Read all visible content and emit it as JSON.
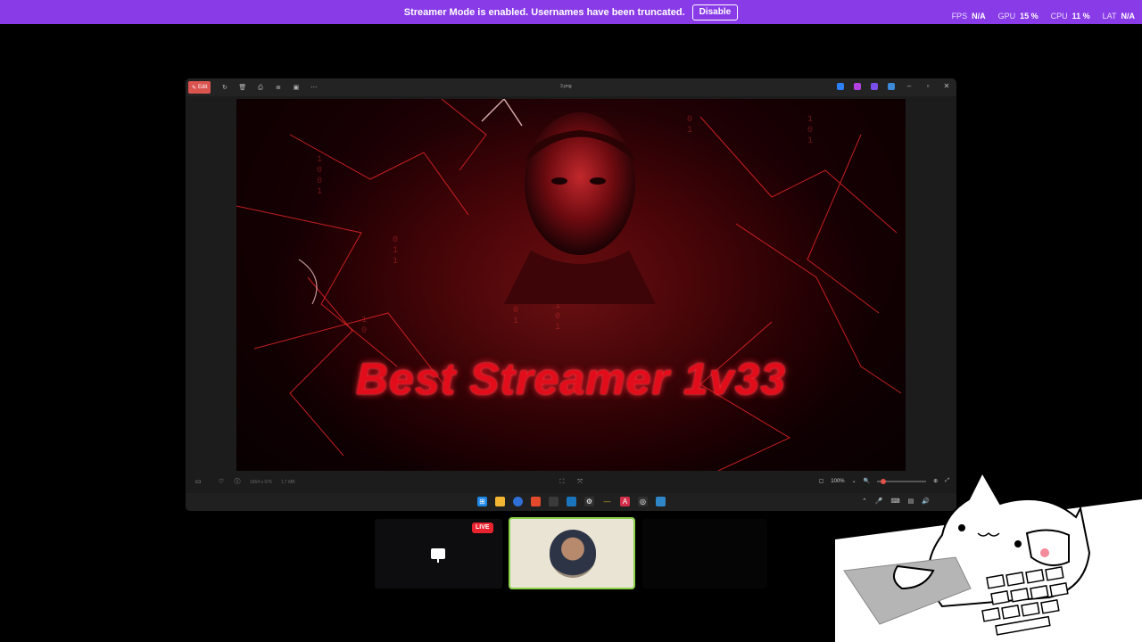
{
  "banner": {
    "message": "Streamer Mode is enabled. Usernames have been truncated.",
    "button_label": "Disable"
  },
  "stats": [
    {
      "label": "FPS",
      "value": "N/A"
    },
    {
      "label": "GPU",
      "value": "15 %"
    },
    {
      "label": "CPU",
      "value": "11 %"
    },
    {
      "label": "LAT",
      "value": "N/A"
    }
  ],
  "viewer": {
    "edit_label": "Edit",
    "file_name": "3.png",
    "image_text": "Best Streamer 1v33",
    "dimensions": "1664 x 976",
    "file_size": "1.7 MB",
    "zoom_value": "100%"
  },
  "scenes": {
    "live_label": "LIVE"
  },
  "colors": {
    "banner": "#8a3be8",
    "title_red": "#e10d1a",
    "live_red": "#e8222e",
    "active_border": "#8bd14a"
  }
}
